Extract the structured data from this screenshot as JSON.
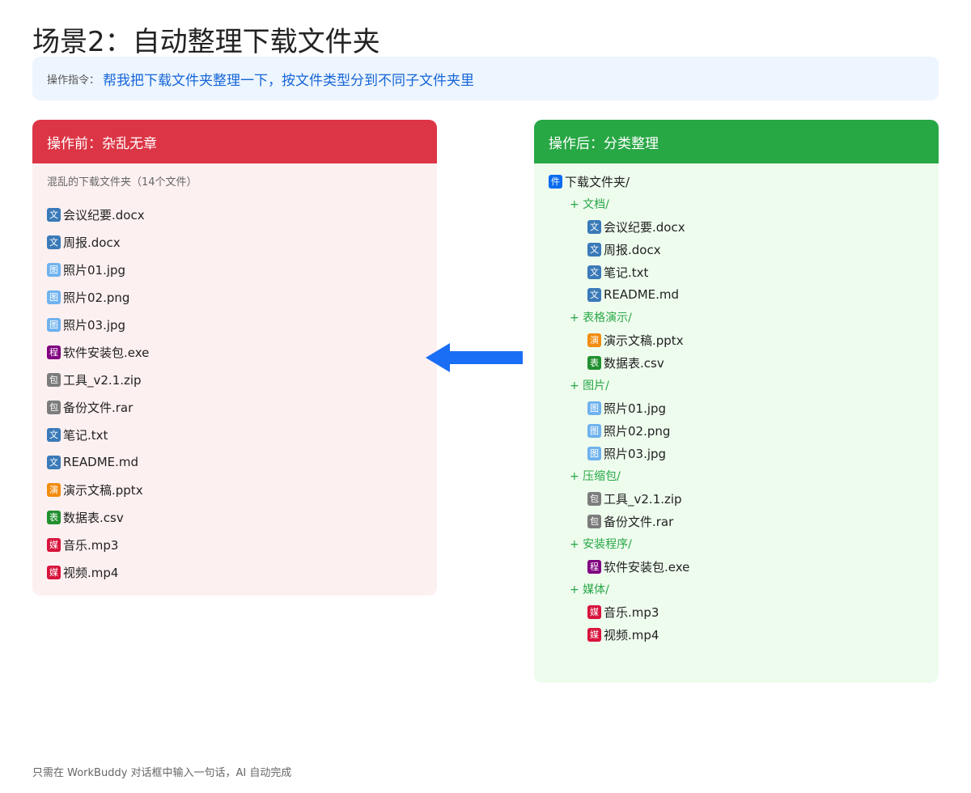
{
  "title": "场景2：自动整理下载文件夹",
  "instruction": {
    "label": "操作指令：",
    "text": "帮我把下载文件夹整理一下，按文件类型分到不同子文件夹里"
  },
  "before": {
    "header": "操作前：杂乱无章",
    "subtitle": "混乱的下载文件夹（14个文件）",
    "files": [
      {
        "icon": "文",
        "type": "doc",
        "name": "会议纪要.docx"
      },
      {
        "icon": "文",
        "type": "doc",
        "name": "周报.docx"
      },
      {
        "icon": "图",
        "type": "img",
        "name": "照片01.jpg"
      },
      {
        "icon": "图",
        "type": "img",
        "name": "照片02.png"
      },
      {
        "icon": "图",
        "type": "img",
        "name": "照片03.jpg"
      },
      {
        "icon": "程",
        "type": "exe",
        "name": "软件安装包.exe"
      },
      {
        "icon": "包",
        "type": "zip",
        "name": "工具_v2.1.zip"
      },
      {
        "icon": "包",
        "type": "zip",
        "name": "备份文件.rar"
      },
      {
        "icon": "文",
        "type": "doc",
        "name": "笔记.txt"
      },
      {
        "icon": "文",
        "type": "doc",
        "name": "README.md"
      },
      {
        "icon": "演",
        "type": "ppt",
        "name": "演示文稿.pptx"
      },
      {
        "icon": "表",
        "type": "csv",
        "name": "数据表.csv"
      },
      {
        "icon": "媒",
        "type": "med",
        "name": "音乐.mp3"
      },
      {
        "icon": "媒",
        "type": "med",
        "name": "视频.mp4"
      }
    ]
  },
  "after": {
    "header": "操作后：分类整理",
    "root": {
      "icon": "件",
      "name": "下载文件夹/"
    },
    "folders": [
      {
        "name": "+ 文档/",
        "files": [
          {
            "icon": "文",
            "type": "doc",
            "name": "会议纪要.docx"
          },
          {
            "icon": "文",
            "type": "doc",
            "name": "周报.docx"
          },
          {
            "icon": "文",
            "type": "doc",
            "name": "笔记.txt"
          },
          {
            "icon": "文",
            "type": "doc",
            "name": "README.md"
          }
        ]
      },
      {
        "name": "+ 表格演示/",
        "files": [
          {
            "icon": "演",
            "type": "ppt",
            "name": "演示文稿.pptx"
          },
          {
            "icon": "表",
            "type": "csv",
            "name": "数据表.csv"
          }
        ]
      },
      {
        "name": "+ 图片/",
        "files": [
          {
            "icon": "图",
            "type": "img",
            "name": "照片01.jpg"
          },
          {
            "icon": "图",
            "type": "img",
            "name": "照片02.png"
          },
          {
            "icon": "图",
            "type": "img",
            "name": "照片03.jpg"
          }
        ]
      },
      {
        "name": "+ 压缩包/",
        "files": [
          {
            "icon": "包",
            "type": "zip",
            "name": "工具_v2.1.zip"
          },
          {
            "icon": "包",
            "type": "zip",
            "name": "备份文件.rar"
          }
        ]
      },
      {
        "name": "+ 安装程序/",
        "files": [
          {
            "icon": "程",
            "type": "exe",
            "name": "软件安装包.exe"
          }
        ]
      },
      {
        "name": "+ 媒体/",
        "files": [
          {
            "icon": "媒",
            "type": "med",
            "name": "音乐.mp3"
          },
          {
            "icon": "媒",
            "type": "med",
            "name": "视频.mp4"
          }
        ]
      }
    ]
  },
  "footer": "只需在 WorkBuddy 对话框中输入一句话，AI 自动完成",
  "colors": {
    "before_header": "#dc3545",
    "after_header": "#28a745",
    "arrow": "#1a6ef5",
    "instruction_text": "#1565d8"
  }
}
